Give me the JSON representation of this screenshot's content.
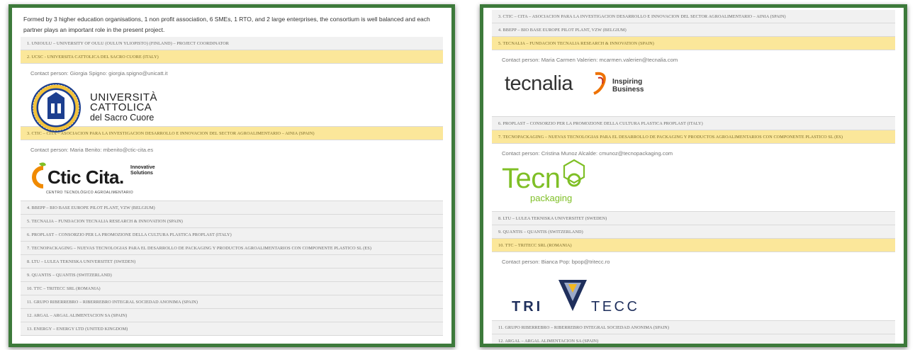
{
  "left": {
    "intro_line1": "Formed by 3 higher education organisations, 1 non profit association, 6 SMEs, 1 RTO, and 2 large enterprises, the consortium is well balanced and each",
    "intro_line2": "partner plays an important role in the present project.",
    "items_top": [
      {
        "label": "1. UNIOULU – UNIVERSITY OF OULU (OULUN YLIOPISTO) (FINLAND) – Project coordinator",
        "active": false
      },
      {
        "label": "2. UCSC - UNIVERSITA CATTOLICA DEL SACRO CUORE (ITALY)",
        "active": true
      }
    ],
    "ucsc": {
      "contact": "Contact person: Giorgia Spigno: giorgia.spigno@unicatt.it",
      "logo_line1": "UNIVERSITÀ",
      "logo_line2": "CATTOLICA",
      "logo_line3": "del Sacro Cuore"
    },
    "item_ctic": {
      "label": "3. CTIC – CITA – ASOCIACION PARA LA INVESTIGACION DESARROLLO E INNOVACION DEL SECTOR AGROALIMENTARIO – AINIA (SPAIN)",
      "active": true
    },
    "ctic": {
      "contact": "Contact person: Maria Benito: mbenito@ctic-cita.es",
      "logo_name": "Ctic Cita.",
      "logo_tag1": "Innovative",
      "logo_tag2": "Solutions",
      "logo_sub": "CENTRO TECNOLÓGICO AGROALIMENTARIO"
    },
    "items_bottom": [
      {
        "label": "4. BBEPP – BIO BASE EUROPE PILOT PLANT, VZW (BELGIUM)"
      },
      {
        "label": "5. TECNALIA – FUNDACION TECNALIA RESEARCH & INNOVATION (SPAIN)"
      },
      {
        "label": "6. PROPLAST – CONSORZIO PER LA PROMOZIONE DELLA CULTURA PLASTICA PROPLAST (ITALY)"
      },
      {
        "label": "7. TECNOPACKAGING – NUEVAS TECNOLOGIAS PARA EL DESARROLLO DE PACKAGING Y PRODUCTOS AGROALIMENTARIOS CON COMPONENTE PLASTICO SL (ES)"
      },
      {
        "label": "8. LTU – LULEA TEKNISKA UNIVERSITET (SWEDEN)"
      },
      {
        "label": "9. QUANTIS – QUANTIS (SWITZERLAND)"
      },
      {
        "label": "10. TTC – TRITECC SRL (ROMANIA)"
      },
      {
        "label": "11. GRUPO RIBERREBRO – RIBERREBRO INTEGRAL SOCIEDAD ANONIMA (SPAIN)"
      },
      {
        "label": "12. ARGAL – ARGAL ALIMENTACION SA (SPAIN)"
      },
      {
        "label": "13. ENERGY – ENERGY LTD (UNITED KINGDOM)"
      }
    ]
  },
  "right": {
    "items_top": [
      {
        "label": "3. CTIC – CITA – ASOCIACION PARA LA INVESTIGACION DESARROLLO E INNOVACION DEL SECTOR AGROALIMENTARIO – AINIA (SPAIN)",
        "active": false
      },
      {
        "label": "4. BBEPP – BIO BASE EUROPE PILOT PLANT, VZW (BELGIUM)",
        "active": false
      },
      {
        "label": "5. TECNALIA – FUNDACION TECNALIA RESEARCH & INNOVATION (SPAIN)",
        "active": true
      }
    ],
    "tecnalia": {
      "contact": "Contact person: Maria Carmen Valerien: mcarmen.valerien@tecnalia.com",
      "logo_name": "tecnalia",
      "logo_tag1": "Inspiring",
      "logo_tag2": "Business"
    },
    "items_mid": [
      {
        "label": "6. PROPLAST – CONSORZIO PER LA PROMOZIONE DELLA CULTURA PLASTICA PROPLAST (ITALY)",
        "active": false
      },
      {
        "label": "7. TECNOPACKAGING – NUEVAS TECNOLOGIAS PARA EL DESARROLLO DE PACKAGING Y PRODUCTOS AGROALIMENTARIOS CON COMPONENTE PLASTICO SL (ES)",
        "active": true
      }
    ],
    "tecno": {
      "contact": "Contact person: Cristina Munoz Alcalde: cmunoz@tecnopackaging.com",
      "logo_name": "Tecn",
      "logo_sub": "packaging"
    },
    "items_mid2": [
      {
        "label": "8. LTU – LULEA TEKNISKA UNIVERSITET (SWEDEN)",
        "active": false
      },
      {
        "label": "9. QUANTIS – QUANTIS (SWITZERLAND)",
        "active": false
      },
      {
        "label": "10. TTC – TRITECC SRL (ROMANIA)",
        "active": true
      }
    ],
    "tritecc": {
      "contact": "Contact person: Bianca Pop: bpop@tritecc.ro",
      "logo_left": "TRI",
      "logo_right": "TECC"
    },
    "items_bottom": [
      {
        "label": "11. GRUPO RIBERREBRO – RIBERREBRO INTEGRAL SOCIEDAD ANONIMA (SPAIN)"
      },
      {
        "label": "12. ARGAL – ARGAL ALIMENTACION SA (SPAIN)"
      }
    ]
  },
  "colors": {
    "frame_green": "#3d7a3b",
    "active_row": "#fbe79a",
    "inactive_row": "#f1f1f1",
    "ucsc_blue": "#1d3f8f",
    "ctic_orange": "#f08a00",
    "tecnalia_orange": "#ee7203",
    "tecno_green": "#7fbf26",
    "tritecc_navy": "#1f2f5c",
    "tritecc_gold": "#f2b71f"
  },
  "icons": [
    "ucsc-seal-icon",
    "ctic-leaf-icon",
    "tecnalia-swoosh-icon",
    "tecno-hexagon-icon",
    "tritecc-triangle-icon"
  ]
}
